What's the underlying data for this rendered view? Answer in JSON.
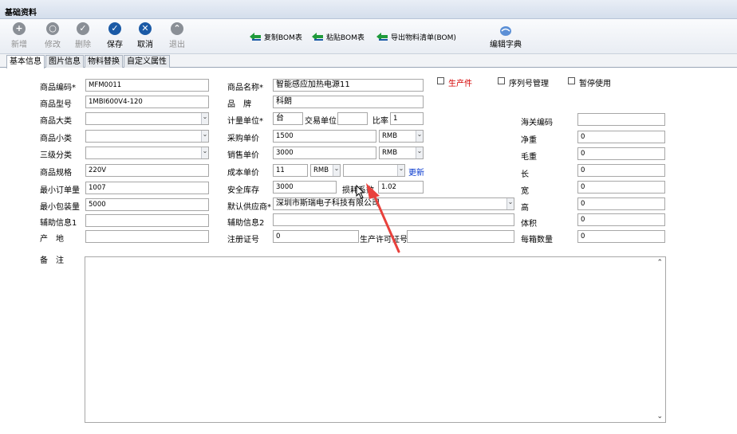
{
  "window": {
    "title": "基础资料"
  },
  "toolbar": {
    "buttons": [
      {
        "label": "新增",
        "glyph": "+",
        "enabled": false,
        "icon": "plus-icon"
      },
      {
        "label": "修改",
        "glyph": "○",
        "enabled": false,
        "icon": "edit-icon"
      },
      {
        "label": "删除",
        "glyph": "✓",
        "enabled": false,
        "icon": "delete-icon"
      },
      {
        "label": "保存",
        "glyph": "✓",
        "enabled": true,
        "icon": "save-icon"
      },
      {
        "label": "取消",
        "glyph": "✕",
        "enabled": true,
        "icon": "cancel-icon"
      },
      {
        "label": "退出",
        "glyph": "⌃",
        "enabled": false,
        "icon": "exit-icon"
      }
    ],
    "links": [
      {
        "label": "复制BOM表",
        "icon": "copy-arrow-icon"
      },
      {
        "label": "粘贴BOM表",
        "icon": "paste-arrow-icon"
      },
      {
        "label": "导出物料清单(BOM)",
        "icon": "export-arrow-icon"
      }
    ],
    "dictionary": {
      "label": "编辑字典",
      "icon": "dictionary-icon"
    }
  },
  "tabs": [
    "基本信息",
    "图片信息",
    "物料替换",
    "自定义属性"
  ],
  "labels": {
    "product_code": "商品编码*",
    "product_model": "商品型号",
    "major_category": "商品大类",
    "minor_category": "商品小类",
    "level3_category": "三级分类",
    "spec": "商品规格",
    "min_order": "最小订单量",
    "min_pack": "最小包装量",
    "aux1": "辅助信息1",
    "origin": "产　地",
    "product_name": "商品名称*",
    "brand": "品　牌",
    "unit": "计量单位*",
    "trade_unit": "交易单位",
    "ratio": "比率",
    "purchase_price": "采购单价",
    "sale_price": "销售单价",
    "cost_price": "成本单价",
    "safety_stock": "安全库存",
    "loss_factor": "损耗系数",
    "default_supplier": "默认供应商*",
    "aux2": "辅助信息2",
    "reg_no": "注册证号",
    "license_no": "生产许可证号",
    "customs_code": "海关编码",
    "net_weight": "净重",
    "gross_weight": "毛重",
    "length": "长",
    "width": "宽",
    "height": "高",
    "volume": "体积",
    "per_box": "每箱数量",
    "remarks": "备　注"
  },
  "values": {
    "product_code": "MFM0011",
    "product_model": "1MBI600V4-120",
    "major_category": "",
    "minor_category": "",
    "level3_category": "",
    "spec": "220V",
    "min_order": "1007",
    "min_pack": "5000",
    "aux1": "",
    "origin": "",
    "product_name": "智能感应加热电源11",
    "brand": "科朗",
    "unit": "台",
    "trade_unit": "",
    "ratio": "1",
    "purchase_price": "1500",
    "purchase_currency": "RMB",
    "sale_price": "3000",
    "sale_currency": "RMB",
    "cost_price": "11",
    "cost_currency": "RMB",
    "cost_extra": "",
    "safety_stock": "3000",
    "loss_factor": "1.02",
    "default_supplier": "深圳市斯瑞电子科技有限公司",
    "aux2": "",
    "reg_no": "0",
    "license_no": "",
    "customs_code": "",
    "net_weight": "0",
    "gross_weight": "0",
    "length": "0",
    "width": "0",
    "height": "0",
    "volume": "0",
    "per_box": "0",
    "remarks": ""
  },
  "checkboxes": {
    "produced": {
      "label": "生产件",
      "checked": false,
      "color": "#d40000"
    },
    "serial_mgmt": {
      "label": "序列号管理",
      "checked": false
    },
    "suspended": {
      "label": "暂停使用",
      "checked": false
    }
  },
  "update_link": "更新",
  "accent": {
    "primary": "#1b5aa6",
    "annotation": "#e8413c"
  }
}
